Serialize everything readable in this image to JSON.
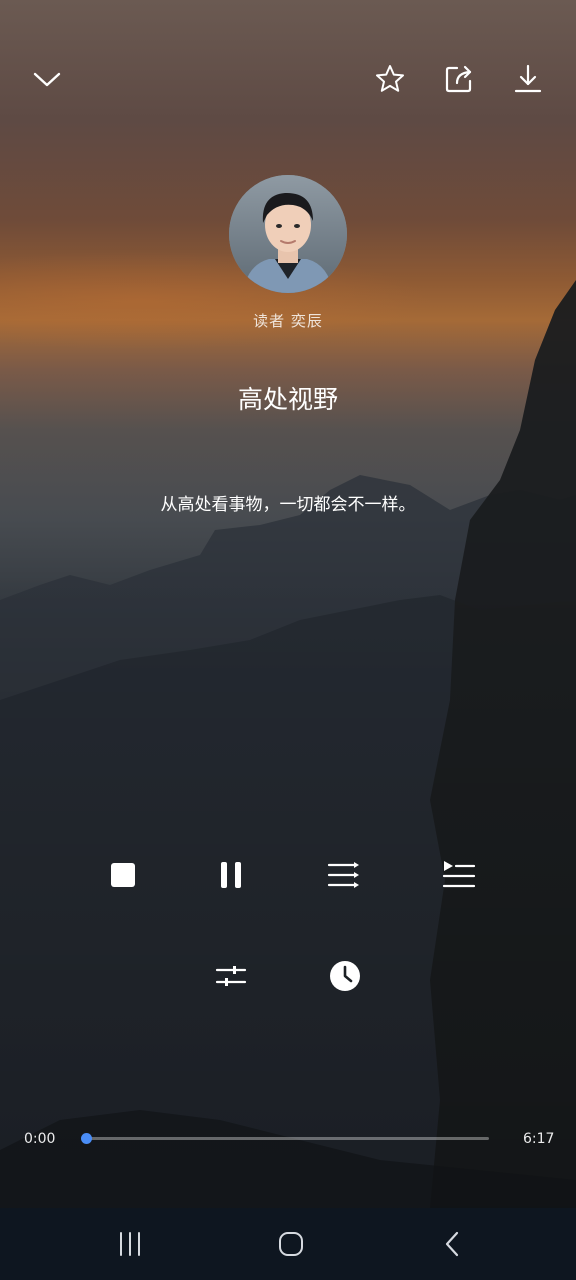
{
  "header": {
    "collapse_icon": "chevron-down-icon",
    "favorite_icon": "star-icon",
    "share_icon": "share-icon",
    "download_icon": "download-icon"
  },
  "reader": {
    "label": "读者  奕辰"
  },
  "track": {
    "title": "高处视野",
    "description": "从高处看事物，一切都会不一样。"
  },
  "controls": {
    "stop_icon": "stop-icon",
    "pause_icon": "pause-icon",
    "playlist_icon": "playlist-icon",
    "queue_icon": "play-queue-icon",
    "settings_icon": "equalizer-icon",
    "timer_icon": "clock-icon"
  },
  "progress": {
    "current": "0:00",
    "total": "6:17",
    "fraction": 0.0
  },
  "colors": {
    "accent": "#4a8df6",
    "navbar": "#0e1620"
  },
  "system_nav": {
    "recents_icon": "recent-apps-icon",
    "home_icon": "home-icon",
    "back_icon": "back-icon"
  }
}
